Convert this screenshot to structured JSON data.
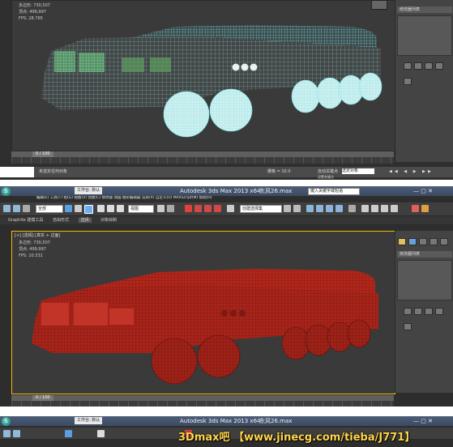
{
  "panel1": {
    "stats": {
      "polys_label": "多边形",
      "polys_value": "730,507",
      "verts_label": "顶点",
      "verts_value": "499,997",
      "fps_label": "FPS:",
      "fps_value": "28.765"
    },
    "right_panel": {
      "header": "修改器列表"
    },
    "timeline": {
      "frame": "0 / 100"
    },
    "status": {
      "prompt": "未选定任何对象",
      "grid": "栅格 = 10.0",
      "autokey": "自动关键点",
      "selected": "选定对象",
      "setkey": "设置关键点"
    }
  },
  "panel2": {
    "app_title": "Autodesk 3ds Max  2013 x64",
    "file_name": "东风26.max",
    "workspace": "工作台: 默认",
    "search_placeholder": "键入关键字或短语",
    "menu_items": [
      "编辑(E)",
      "工具(T)",
      "组(G)",
      "视图(V)",
      "创建(C)",
      "修改器",
      "动画",
      "图形编辑器",
      "渲染(R)",
      "自定义(U)",
      "MAXScript(M)",
      "帮助(H)"
    ],
    "toolbar": {
      "selection_filter": "全部",
      "reference_coord": "视图",
      "named_selection": "创建选择集"
    },
    "ribbon_tabs": [
      "Graphite 建模工具",
      "自由形式",
      "选择",
      "对象绘制"
    ],
    "viewport_label": "[+] [透视] [真实 + 边面]",
    "stats": {
      "polys_label": "多边形",
      "polys_value": "730,507",
      "verts_label": "顶点",
      "verts_value": "499,997",
      "fps_label": "FPS:",
      "fps_value": "10.331"
    },
    "right_panel": {
      "header": "修改器列表"
    },
    "timeline": {
      "frame": "0 / 100"
    }
  },
  "panel3": {
    "app_title": "Autodesk 3ds Max  2013 x64",
    "file_name": "东风26.max",
    "workspace": "工作台: 默认"
  },
  "watermark": "3Dmax吧 【www.jinecg.com/tieba/J771】",
  "colors": {
    "wire": "#7fe8ea",
    "red_model": "#b1261b",
    "viewport_bg": "#3a3a3a",
    "title_bar": "#4d5d77"
  }
}
